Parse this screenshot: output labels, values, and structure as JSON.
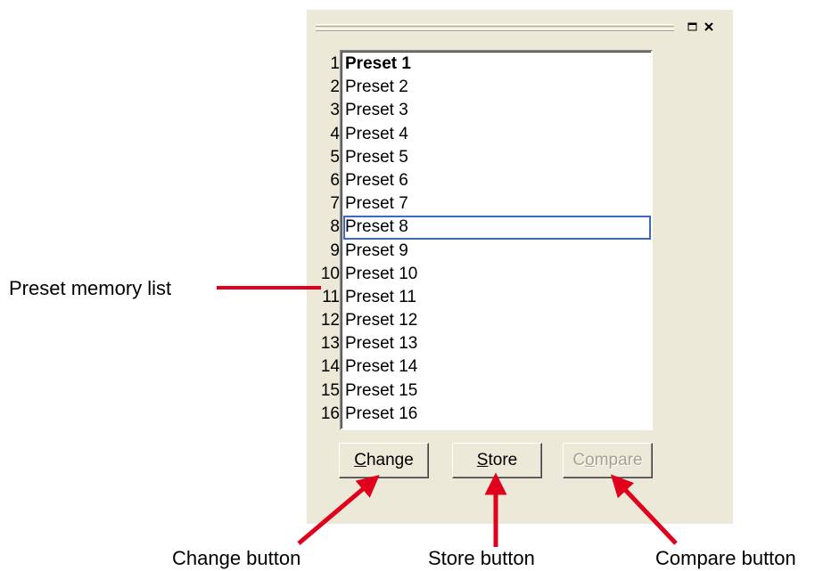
{
  "window_controls": {
    "restore_icon": "restore-window-icon",
    "close_icon": "close-x-icon"
  },
  "preset_list": {
    "numbers": [
      "1",
      "2",
      "3",
      "4",
      "5",
      "6",
      "7",
      "8",
      "9",
      "10",
      "11",
      "12",
      "13",
      "14",
      "15",
      "16"
    ],
    "items": [
      "Preset 1",
      "Preset 2",
      "Preset 3",
      "Preset 4",
      "Preset 5",
      "Preset 6",
      "Preset 7",
      "Preset 8",
      "Preset 9",
      "Preset 10",
      "Preset 11",
      "Preset 12",
      "Preset 13",
      "Preset 14",
      "Preset 15",
      "Preset 16"
    ],
    "active_item": "Preset 1",
    "focused_item": "Preset 8"
  },
  "buttons": {
    "change": {
      "accel": "C",
      "rest": "hange",
      "enabled": true
    },
    "store": {
      "accel": "S",
      "rest": "tore",
      "enabled": true
    },
    "compare": {
      "accel": "o",
      "prefix": "C",
      "rest": "mpare",
      "enabled": false
    }
  },
  "annotations": {
    "preset_memory_list": "Preset memory list",
    "change_button": "Change button",
    "store_button": "Store button",
    "compare_button": "Compare button",
    "arrow_color": "#e0001b"
  },
  "colors": {
    "panel_bg": "#ece9d8",
    "focus_outline": "#3b67c6",
    "disabled_text": "#a6a390"
  }
}
